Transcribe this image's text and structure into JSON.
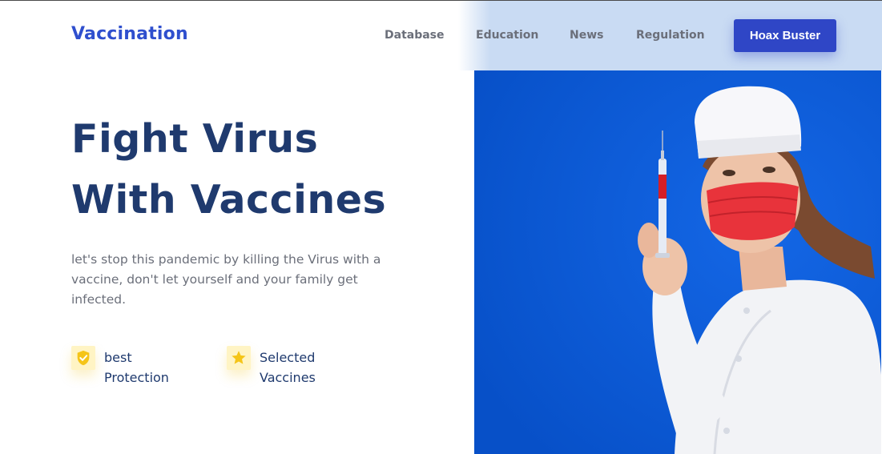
{
  "brand": {
    "name": "Vaccination"
  },
  "nav": {
    "links": [
      "Database",
      "Education",
      "News",
      "Regulation"
    ],
    "cta": "Hoax Buster"
  },
  "hero": {
    "title_line1": "Fight Virus",
    "title_line2": "With Vaccines",
    "description": "let's stop this pandemic by killing the Virus with a vaccine, don't let yourself and your family get infected.",
    "features": [
      {
        "icon": "shield-check-icon",
        "line1": "best",
        "line2": "Protection"
      },
      {
        "icon": "star-icon",
        "line1": "Selected",
        "line2": "Vaccines"
      }
    ]
  },
  "colors": {
    "brand": "#2f4fce",
    "heading": "#1f3a6e",
    "cta": "#2f46c6",
    "accent_yellow": "#f5c518",
    "photo_background": "#0a5ad6"
  }
}
